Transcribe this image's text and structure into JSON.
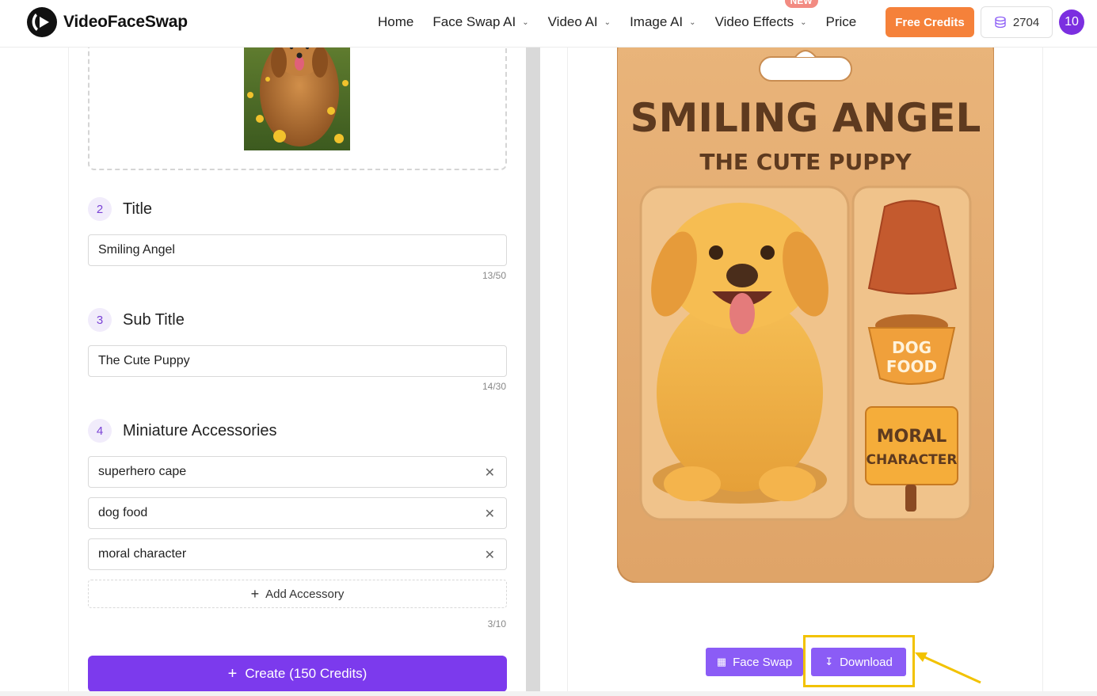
{
  "header": {
    "brand": "VideoFaceSwap",
    "nav": [
      {
        "label": "Home",
        "has_dropdown": false
      },
      {
        "label": "Face Swap AI",
        "has_dropdown": true
      },
      {
        "label": "Video AI",
        "has_dropdown": true
      },
      {
        "label": "Image AI",
        "has_dropdown": true
      },
      {
        "label": "Video Effects",
        "has_dropdown": true,
        "badge": "NEW"
      },
      {
        "label": "Price",
        "has_dropdown": false
      }
    ],
    "free_credits_label": "Free Credits",
    "credits_balance": "2704",
    "avatar_label": "10",
    "accent_orange": "#f5813a",
    "accent_purple": "#7c3aed"
  },
  "form": {
    "steps": [
      {
        "num": "2",
        "label": "Title",
        "value": "Smiling Angel",
        "count": "13/50"
      },
      {
        "num": "3",
        "label": "Sub Title",
        "value": "The Cute Puppy",
        "count": "14/30"
      }
    ],
    "accessories": {
      "num": "4",
      "label": "Miniature Accessories",
      "items": [
        "superhero cape",
        "dog food",
        "moral character"
      ],
      "add_label": "Add Accessory",
      "count": "3/10"
    },
    "create_label": "Create (150 Credits)"
  },
  "preview": {
    "package_title": "SMILING ANGEL",
    "package_subtitle": "THE CUTE PUPPY",
    "bowl_text_line1": "DOG",
    "bowl_text_line2": "FOOD",
    "sign_text_line1": "MORAL",
    "sign_text_line2": "CHARACTER",
    "face_swap_label": "Face Swap",
    "download_label": "Download"
  }
}
